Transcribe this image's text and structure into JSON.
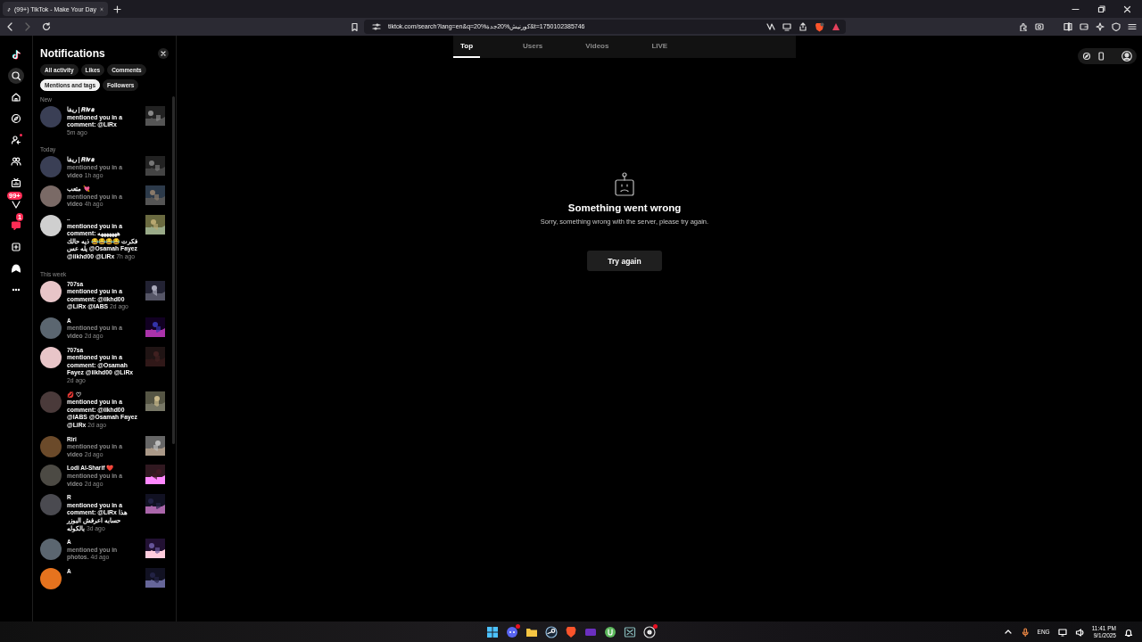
{
  "browser": {
    "tabs": [
      {
        "title": "(99+) TikTok - Make Your Day",
        "selected": true
      }
    ],
    "url": "tiktok.com/search?lang=en&q=20%کورنیش%20جدة&t=1750102385746"
  },
  "rail": [
    {
      "kind": "logo",
      "selected": false,
      "dot": false
    },
    {
      "kind": "search",
      "selected": true,
      "dot": false
    },
    {
      "kind": "home",
      "selected": false,
      "dot": false
    },
    {
      "kind": "explore",
      "selected": false,
      "dot": false
    },
    {
      "kind": "following",
      "selected": false,
      "dot": true
    },
    {
      "kind": "friends",
      "selected": false,
      "dot": false
    },
    {
      "kind": "live",
      "selected": false,
      "dot": false
    },
    {
      "kind": "activity",
      "selected": false,
      "dot": false,
      "badge": "99+"
    },
    {
      "kind": "messages",
      "selected": false,
      "dot": false,
      "badge": "1"
    },
    {
      "kind": "upload",
      "selected": false,
      "dot": false
    },
    {
      "kind": "profile",
      "selected": false,
      "dot": false
    },
    {
      "kind": "more",
      "selected": false,
      "dot": false
    }
  ],
  "notifications": {
    "title": "Notifications",
    "filters": [
      [
        {
          "label": "All activity",
          "selected": false
        },
        {
          "label": "Likes",
          "selected": false
        },
        {
          "label": "Comments",
          "selected": false
        }
      ],
      [
        {
          "label": "Mentions and tags",
          "selected": true
        },
        {
          "label": "Followers",
          "selected": false
        }
      ]
    ],
    "sections": [
      {
        "heading": "New",
        "items": [
          {
            "name": "ریفا | 𝑹𝒊𝒗𝒂",
            "kind": "comment",
            "text": "mentioned you in a comment: @LiRx",
            "time": "5m ago"
          }
        ]
      },
      {
        "heading": "Today",
        "items": [
          {
            "name": "ریفا | 𝑹𝒊𝒗𝒂",
            "kind": "video",
            "text": "mentioned you in a video",
            "time": "1h ago"
          },
          {
            "name": "متعب 💘",
            "kind": "video",
            "text": "mentioned you in a video",
            "time": "4h ago"
          },
          {
            "name": "..",
            "kind": "comment",
            "text": "mentioned you in a comment: هههههههه فكرت 😂😂😂😂 ذيه حالك يله عس @Osamah Fayez @iikhd00 @LiRx",
            "time": "7h ago"
          }
        ]
      },
      {
        "heading": "This week",
        "items": [
          {
            "name": "707sa",
            "kind": "comment",
            "text": "mentioned you in a comment: @iikhd00 @LiRx @IABS",
            "time": "2d ago"
          },
          {
            "name": "A",
            "kind": "video",
            "text": "mentioned you in a video",
            "time": "2d ago"
          },
          {
            "name": "707sa",
            "kind": "comment",
            "text": "mentioned you in a comment: @Osamah Fayez @iikhd00 @LiRx",
            "time": "2d ago"
          },
          {
            "name": "💋 ♡",
            "kind": "comment",
            "text": "mentioned you in a comment: @iikhd00 @IABS @Osamah Fayez @LiRx",
            "time": "2d ago"
          },
          {
            "name": "Riri",
            "kind": "video",
            "text": "mentioned you in a video",
            "time": "2d ago"
          },
          {
            "name": "Lodi Al-Sharif ❤️",
            "kind": "video",
            "text": "mentioned you in a video",
            "time": "2d ago"
          },
          {
            "name": "R",
            "kind": "comment",
            "text": "mentioned you in a comment: @LiRx هذا حسابه اعرفش البوزر بالكوله",
            "time": "3d ago"
          },
          {
            "name": "A",
            "kind": "photos",
            "text": "mentioned you in photos.",
            "time": "4d ago"
          },
          {
            "name": "A",
            "kind": "cut"
          }
        ]
      }
    ]
  },
  "search": {
    "tabs": [
      {
        "label": "Top",
        "selected": true
      },
      {
        "label": "Users",
        "selected": false
      },
      {
        "label": "Videos",
        "selected": false
      },
      {
        "label": "LIVE",
        "selected": false
      }
    ],
    "error": {
      "title": "Something went wrong",
      "message": "Sorry, something wrong with the server, please try again.",
      "button": "Try again"
    }
  },
  "taskbar": {
    "apps": [
      {
        "kind": "start",
        "badge": false
      },
      {
        "kind": "chat",
        "badge": true
      },
      {
        "kind": "folder",
        "badge": false
      },
      {
        "kind": "steam",
        "badge": false
      },
      {
        "kind": "brave",
        "badge": false
      },
      {
        "kind": "purple",
        "badge": false
      },
      {
        "kind": "torrent",
        "badge": false
      },
      {
        "kind": "sheet",
        "badge": false
      },
      {
        "kind": "obs",
        "badge": true
      }
    ],
    "language": "ENG",
    "time": "11:41 PM",
    "date": "9/1/2025"
  }
}
